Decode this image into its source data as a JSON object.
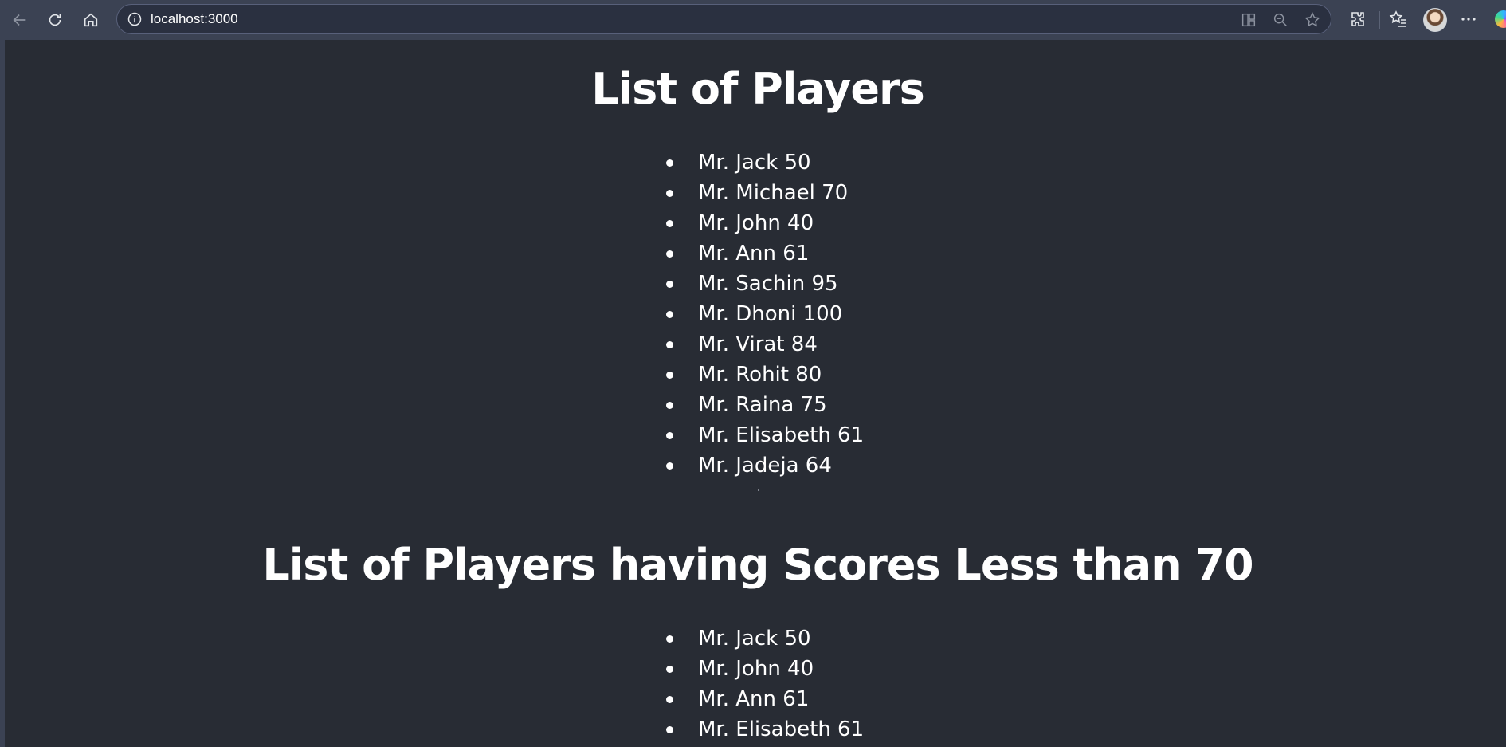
{
  "browser": {
    "url": "localhost:3000",
    "icons": {
      "back": "back-arrow-icon",
      "reload": "reload-icon",
      "home": "home-icon",
      "site_info": "info-icon",
      "split_screen": "split-screen-icon",
      "zoom_out": "zoom-out-icon",
      "favorite": "star-icon",
      "extensions": "puzzle-icon",
      "favorites": "favorites-list-icon",
      "profile": "avatar",
      "more": "more-icon",
      "copilot": "copilot-icon"
    }
  },
  "page": {
    "heading_all": "List of Players",
    "players_all": [
      "Mr. Jack 50",
      "Mr. Michael 70",
      "Mr. John 40",
      "Mr. Ann 61",
      "Mr. Sachin 95",
      "Mr. Dhoni 100",
      "Mr. Virat 84",
      "Mr. Rohit 80",
      "Mr. Raina 75",
      "Mr. Elisabeth 61",
      "Mr. Jadeja 64"
    ],
    "heading_filtered": "List of Players having Scores Less than 70",
    "players_filtered": [
      "Mr. Jack 50",
      "Mr. John 40",
      "Mr. Ann 61",
      "Mr. Elisabeth 61"
    ]
  },
  "colors": {
    "page_background": "#282c34",
    "chrome_background": "#3b4253",
    "text": "#ffffff"
  }
}
